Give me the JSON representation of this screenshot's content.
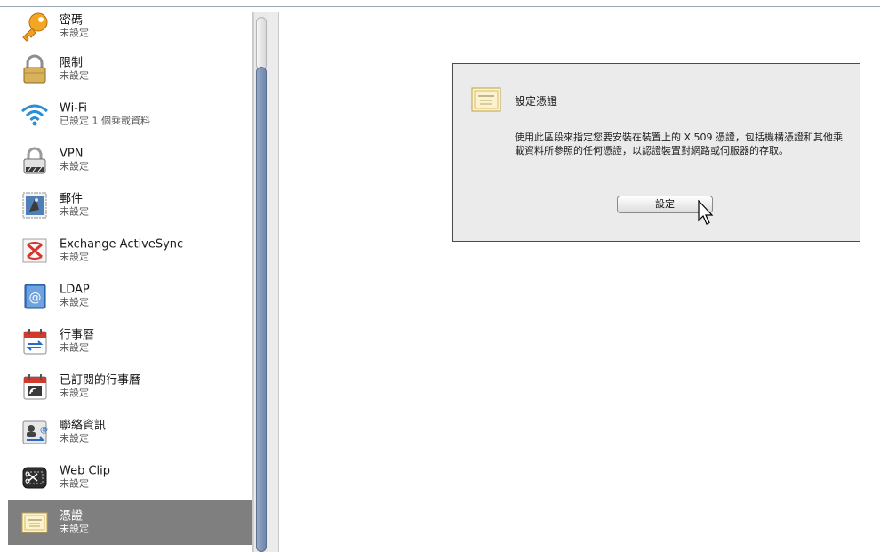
{
  "sidebar": {
    "items": [
      {
        "title": "密碼",
        "subtitle": "未設定",
        "icon": "key-icon"
      },
      {
        "title": "限制",
        "subtitle": "未設定",
        "icon": "padlock-icon"
      },
      {
        "title": "Wi-Fi",
        "subtitle": "已設定 1 個乘載資料",
        "icon": "wifi-icon"
      },
      {
        "title": "VPN",
        "subtitle": "未設定",
        "icon": "vpn-lock-icon"
      },
      {
        "title": "郵件",
        "subtitle": "未設定",
        "icon": "mail-stamp-icon"
      },
      {
        "title": "Exchange ActiveSync",
        "subtitle": "未設定",
        "icon": "exchange-icon"
      },
      {
        "title": "LDAP",
        "subtitle": "未設定",
        "icon": "ldap-address-book-icon"
      },
      {
        "title": "行事曆",
        "subtitle": "未設定",
        "icon": "calendar-sync-icon"
      },
      {
        "title": "已訂閱的行事曆",
        "subtitle": "未設定",
        "icon": "calendar-subscribed-icon"
      },
      {
        "title": "聯絡資訊",
        "subtitle": "未設定",
        "icon": "contacts-icon"
      },
      {
        "title": "Web Clip",
        "subtitle": "未設定",
        "icon": "web-clip-icon"
      },
      {
        "title": "憑證",
        "subtitle": "未設定",
        "icon": "certificate-icon"
      }
    ],
    "selected_index": 11
  },
  "panel": {
    "title": "設定憑證",
    "description": "使用此區段來指定您要安裝在裝置上的 X.509 憑證，包括機構憑證和其他乘載資料所參照的任何憑證，以認證裝置對網路或伺服器的存取。",
    "button_label": "設定"
  },
  "colors": {
    "selected_row": "#7f7f7f",
    "scroll_thumb": "#7a90b4",
    "panel_background": "#ebebeb"
  }
}
